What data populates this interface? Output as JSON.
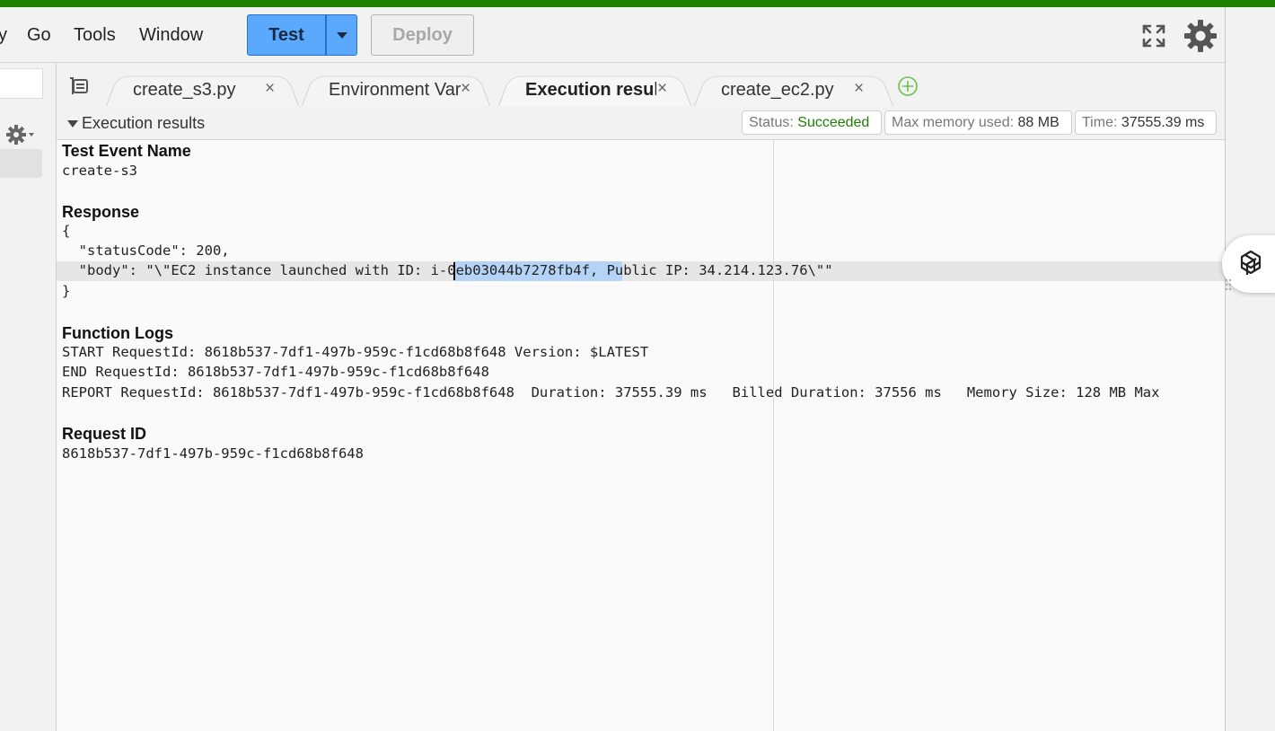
{
  "menu": {
    "items": [
      {
        "label": "y"
      },
      {
        "label": "Go"
      },
      {
        "label": "Tools"
      },
      {
        "label": "Window"
      }
    ],
    "test_label": "Test",
    "deploy_label": "Deploy"
  },
  "tabs": [
    {
      "label": "create_s3.py"
    },
    {
      "label": "Environment Vari"
    },
    {
      "label": "Execution results"
    },
    {
      "label": "create_ec2.py"
    }
  ],
  "close_glyph": "×",
  "results": {
    "title": "Execution results",
    "status_key": "Status:",
    "status_value": "Succeeded",
    "memory_key": "Max memory used:",
    "memory_value": "88 MB",
    "time_key": "Time:",
    "time_value": "37555.39 ms"
  },
  "output": {
    "test_event_heading": "Test Event Name",
    "test_event_value": "create-s3",
    "response_heading": "Response",
    "response_lines": [
      "{",
      "  \"statusCode\": 200,",
      "  \"body\": \"\\\"EC2 instance launched with ID: i-0eb03044b7278fb4f, Public IP: 34.214.123.76\\\"\"",
      "}"
    ],
    "logs_heading": "Function Logs",
    "log_lines": [
      "START RequestId: 8618b537-7df1-497b-959c-f1cd68b8f648 Version: $LATEST",
      "END RequestId: 8618b537-7df1-497b-959c-f1cd68b8f648",
      "REPORT RequestId: 8618b537-7df1-497b-959c-f1cd68b8f648  Duration: 37555.39 ms   Billed Duration: 37556 ms   Memory Size: 128 MB Max"
    ],
    "request_id_heading": "Request ID",
    "request_id_value": "8618b537-7df1-497b-959c-f1cd68b8f648"
  },
  "colors": {
    "accent_bar": "#1d8102",
    "test_button": "#5aa9ff",
    "success": "#1d8102",
    "selection": "#b4d3f7"
  }
}
